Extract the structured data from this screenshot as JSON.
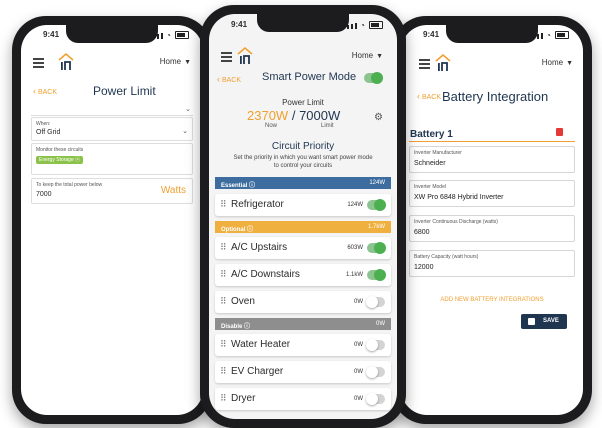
{
  "status": {
    "time": "9:41"
  },
  "common": {
    "home_label": "Home",
    "back_label": "BACK"
  },
  "left": {
    "title": "Power Limit",
    "when_label": "When:",
    "when_value": "Off Grid",
    "monitor_label": "Monitor these circuits",
    "chip_label": "Energy Storage",
    "keep_label": "To keep the total power below",
    "keep_value": "7000",
    "unit": "Watts"
  },
  "center": {
    "title": "Smart Power Mode",
    "power_limit_label": "Power Limit",
    "now_value": "2370W",
    "slash": "/",
    "limit_value": "7000W",
    "now_label": "Now",
    "limit_label": "Limit",
    "priority_title": "Circuit Priority",
    "priority_desc_1": "Set the priority in which you want smart power mode",
    "priority_desc_2": "to control your circuits",
    "sections": [
      {
        "label": "Essential",
        "value": "124W"
      },
      {
        "label": "Optional",
        "value": "1.7kW"
      },
      {
        "label": "Disable",
        "value": "0W"
      }
    ],
    "rows": [
      {
        "name": "Refrigerator",
        "watts": "124W"
      },
      {
        "name": "A/C Upstairs",
        "watts": "603W"
      },
      {
        "name": "A/C Downstairs",
        "watts": "1.1kW"
      },
      {
        "name": "Oven",
        "watts": "0W"
      },
      {
        "name": "Water Heater",
        "watts": "0W"
      },
      {
        "name": "EV Charger",
        "watts": "0W"
      },
      {
        "name": "Dryer",
        "watts": "0W"
      }
    ]
  },
  "right": {
    "title": "Battery Integration",
    "battery_title": "Battery 1",
    "fields": [
      {
        "label": "Inverter Manufacturer",
        "value": "Schneider"
      },
      {
        "label": "Inverter Model",
        "value": "XW Pro 6848 Hybrid Inverter"
      },
      {
        "label": "Inverter Continuous Discharge (watts)",
        "value": "6800"
      },
      {
        "label": "Battery Capacity (watt hours)",
        "value": "12000"
      }
    ],
    "add_label": "ADD NEW BATTERY INTEGRATIONS",
    "save_label": "SAVE"
  },
  "colors": {
    "accent": "#f0a030",
    "essential": "#3d6d9e",
    "optional": "#f0b040",
    "disable": "#8e8e8e",
    "toggle": "#4caf50",
    "delete": "#e53935",
    "save": "#1f3550"
  }
}
